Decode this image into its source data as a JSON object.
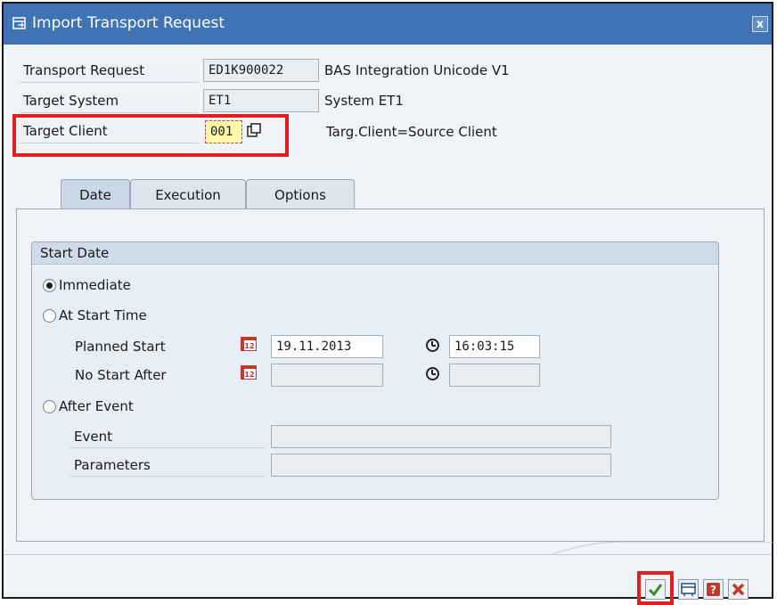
{
  "window": {
    "title": "Import Transport Request",
    "close_label": "x"
  },
  "header_fields": {
    "transport_request": {
      "label": "Transport Request",
      "value": "ED1K900022",
      "description": "BAS Integration Unicode V1"
    },
    "target_system": {
      "label": "Target System",
      "value": "ET1",
      "description": "System ET1"
    },
    "target_client": {
      "label": "Target Client",
      "value": "001",
      "description": "Targ.Client=Source Client"
    }
  },
  "tabs": [
    {
      "label": "Date",
      "active": true
    },
    {
      "label": "Execution",
      "active": false
    },
    {
      "label": "Options",
      "active": false
    }
  ],
  "start_date": {
    "group_title": "Start Date",
    "options": [
      {
        "label": "Immediate",
        "selected": true
      },
      {
        "label": "At Start Time",
        "selected": false
      },
      {
        "label": "After Event",
        "selected": false
      }
    ],
    "planned_start": {
      "label": "Planned Start",
      "date": "19.11.2013",
      "time": "16:03:15"
    },
    "no_start_after": {
      "label": "No Start After",
      "date": "",
      "time": ""
    },
    "event": {
      "label": "Event",
      "value": ""
    },
    "parameters": {
      "label": "Parameters",
      "value": ""
    }
  },
  "footer_buttons": [
    {
      "name": "continue",
      "icon": "checkmark-icon"
    },
    {
      "name": "options",
      "icon": "transport-icon"
    },
    {
      "name": "help",
      "icon": "help-icon"
    },
    {
      "name": "cancel",
      "icon": "cancel-icon"
    }
  ],
  "colors": {
    "title_bar": "#3f73b3",
    "highlight": "#e02020"
  }
}
